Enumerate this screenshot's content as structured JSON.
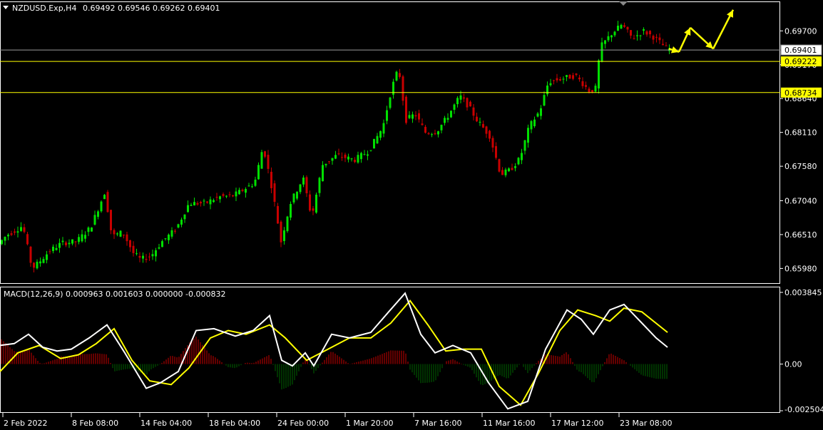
{
  "header": {
    "symbol": "NZDUSD.Exp,H4",
    "ohlc": "0.69492 0.69546 0.69262 0.69401"
  },
  "macd_header": {
    "text": "MACD(12,26,9) 0.000963 0.001603 0.000000 -0.000832"
  },
  "colors": {
    "background": "#000000",
    "bull": "#00e000",
    "bear": "#c80000",
    "level_line": "#ffff00",
    "macd_line": "#ffffff",
    "signal_line": "#ffff00",
    "hist_pos": "#c80000",
    "hist_neg": "#006400",
    "arrow": "#ffff00"
  },
  "chart_data": [
    {
      "type": "candlestick",
      "ylim": [
        0.6575,
        0.7015
      ],
      "y_ticks": [
        "0.69700",
        "0.69170",
        "0.68640",
        "0.68110",
        "0.67580",
        "0.67040",
        "0.66510",
        "0.65980"
      ],
      "x_ticks": [
        "2 Feb 2022",
        "8 Feb 08:00",
        "14 Feb 04:00",
        "18 Feb 04:00",
        "24 Feb 00:00",
        "1 Mar 20:00",
        "7 Mar 16:00",
        "11 Mar 16:00",
        "17 Mar 12:00",
        "23 Mar 08:00"
      ],
      "current_price": "0.69401",
      "level_lines": [
        "0.69222",
        "0.68734"
      ],
      "price_path": [
        [
          0,
          0.6635
        ],
        [
          12,
          0.665
        ],
        [
          25,
          0.6658
        ],
        [
          35,
          0.6665
        ],
        [
          48,
          0.6598
        ],
        [
          58,
          0.6608
        ],
        [
          72,
          0.6625
        ],
        [
          90,
          0.6638
        ],
        [
          110,
          0.664
        ],
        [
          130,
          0.6662
        ],
        [
          150,
          0.6718
        ],
        [
          160,
          0.6648
        ],
        [
          175,
          0.6655
        ],
        [
          190,
          0.6622
        ],
        [
          200,
          0.6612
        ],
        [
          215,
          0.6618
        ],
        [
          230,
          0.664
        ],
        [
          250,
          0.666
        ],
        [
          268,
          0.67
        ],
        [
          290,
          0.67
        ],
        [
          310,
          0.671
        ],
        [
          330,
          0.6712
        ],
        [
          345,
          0.6722
        ],
        [
          360,
          0.6732
        ],
        [
          372,
          0.679
        ],
        [
          385,
          0.672
        ],
        [
          397,
          0.664
        ],
        [
          410,
          0.67
        ],
        [
          428,
          0.674
        ],
        [
          440,
          0.6678
        ],
        [
          455,
          0.676
        ],
        [
          475,
          0.6775
        ],
        [
          500,
          0.6768
        ],
        [
          520,
          0.6782
        ],
        [
          540,
          0.682
        ],
        [
          552,
          0.688
        ],
        [
          562,
          0.6912
        ],
        [
          572,
          0.683
        ],
        [
          585,
          0.684
        ],
        [
          600,
          0.681
        ],
        [
          615,
          0.6812
        ],
        [
          630,
          0.6835
        ],
        [
          648,
          0.6868
        ],
        [
          660,
          0.6852
        ],
        [
          672,
          0.683
        ],
        [
          690,
          0.6805
        ],
        [
          705,
          0.6745
        ],
        [
          718,
          0.6752
        ],
        [
          732,
          0.677
        ],
        [
          745,
          0.682
        ],
        [
          760,
          0.6845
        ],
        [
          772,
          0.689
        ],
        [
          790,
          0.6895
        ],
        [
          810,
          0.69
        ],
        [
          830,
          0.6875
        ],
        [
          838,
          0.688
        ],
        [
          845,
          0.6945
        ],
        [
          860,
          0.6965
        ],
        [
          875,
          0.698
        ],
        [
          890,
          0.6958
        ],
        [
          905,
          0.697
        ],
        [
          920,
          0.696
        ],
        [
          938,
          0.6942
        ]
      ],
      "forecast_arrows": [
        [
          938,
          0.6942
        ],
        [
          952,
          0.6937
        ],
        [
          968,
          0.6975
        ],
        [
          1000,
          0.6942
        ],
        [
          1028,
          0.7003
        ]
      ]
    },
    {
      "type": "macd",
      "params": "12,26,9",
      "ylim": [
        -0.002504,
        0.003845
      ],
      "y_ticks": [
        "0.003845",
        "0.00",
        "-0.002504"
      ],
      "macd_path": [
        [
          0,
          0.001
        ],
        [
          20,
          0.0011
        ],
        [
          40,
          0.0016
        ],
        [
          60,
          0.0009
        ],
        [
          80,
          0.0007
        ],
        [
          100,
          0.0008
        ],
        [
          125,
          0.0014
        ],
        [
          150,
          0.0021
        ],
        [
          175,
          0.0006
        ],
        [
          205,
          -0.0013
        ],
        [
          225,
          -0.001
        ],
        [
          250,
          -0.0004
        ],
        [
          275,
          0.0018
        ],
        [
          300,
          0.0019
        ],
        [
          330,
          0.0015
        ],
        [
          355,
          0.0018
        ],
        [
          378,
          0.0026
        ],
        [
          395,
          0.0002
        ],
        [
          410,
          -0.0001
        ],
        [
          428,
          0.0006
        ],
        [
          440,
          -0.0001
        ],
        [
          465,
          0.0016
        ],
        [
          490,
          0.0014
        ],
        [
          520,
          0.0017
        ],
        [
          545,
          0.0028
        ],
        [
          568,
          0.0038
        ],
        [
          590,
          0.0016
        ],
        [
          610,
          0.0006
        ],
        [
          635,
          0.001
        ],
        [
          660,
          0.0006
        ],
        [
          685,
          -0.001
        ],
        [
          712,
          -0.0024
        ],
        [
          740,
          -0.002
        ],
        [
          765,
          0.0008
        ],
        [
          795,
          0.0029
        ],
        [
          815,
          0.0024
        ],
        [
          832,
          0.0016
        ],
        [
          855,
          0.0029
        ],
        [
          875,
          0.0032
        ],
        [
          900,
          0.0022
        ],
        [
          920,
          0.0014
        ],
        [
          936,
          0.0009
        ]
      ],
      "signal_path": [
        [
          0,
          -0.0004
        ],
        [
          25,
          0.0006
        ],
        [
          55,
          0.001
        ],
        [
          85,
          0.0003
        ],
        [
          110,
          0.0005
        ],
        [
          135,
          0.0011
        ],
        [
          160,
          0.0019
        ],
        [
          185,
          0.0002
        ],
        [
          210,
          -0.0009
        ],
        [
          240,
          -0.0011
        ],
        [
          265,
          -0.0002
        ],
        [
          295,
          0.0014
        ],
        [
          320,
          0.0018
        ],
        [
          345,
          0.0016
        ],
        [
          378,
          0.0021
        ],
        [
          400,
          0.0014
        ],
        [
          430,
          0.0002
        ],
        [
          460,
          0.0008
        ],
        [
          490,
          0.0014
        ],
        [
          520,
          0.0014
        ],
        [
          548,
          0.0022
        ],
        [
          575,
          0.0034
        ],
        [
          600,
          0.0021
        ],
        [
          625,
          0.0007
        ],
        [
          650,
          0.0008
        ],
        [
          675,
          0.0008
        ],
        [
          700,
          -0.0012
        ],
        [
          730,
          -0.0022
        ],
        [
          755,
          -0.0005
        ],
        [
          785,
          0.0018
        ],
        [
          810,
          0.0029
        ],
        [
          835,
          0.0026
        ],
        [
          855,
          0.0023
        ],
        [
          875,
          0.003
        ],
        [
          900,
          0.0028
        ],
        [
          936,
          0.0017
        ]
      ]
    }
  ]
}
